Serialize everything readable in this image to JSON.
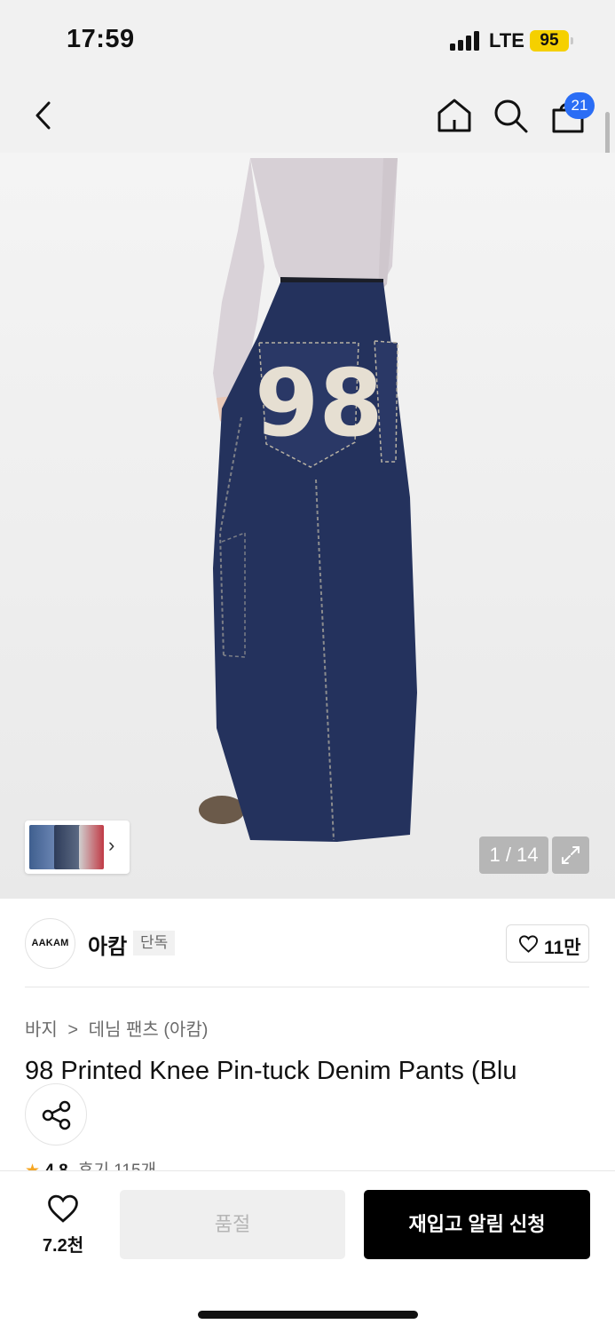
{
  "status_bar": {
    "time": "17:59",
    "network": "LTE",
    "battery": "95",
    "battery_color": "#f5d000"
  },
  "header": {
    "icons": [
      "back-icon",
      "home-icon",
      "search-icon",
      "shopping-bag-icon"
    ],
    "cart_count": "21",
    "badge_color": "#2a6df5"
  },
  "product_image": {
    "print_text": "98",
    "page_indicator": "1 / 14",
    "thumbnail_count": 3
  },
  "brand": {
    "logo_text": "AAKAM",
    "name": "아캄",
    "badge": "단독",
    "likes": "11만"
  },
  "breadcrumb": {
    "category": "바지",
    "separator": ">",
    "subcategory": "데님 팬츠 (아캄)"
  },
  "product": {
    "title": "98 Printed Knee Pin-tuck Denim Pants (Blu",
    "rating": "4.8",
    "reviews": "후기 115개"
  },
  "bottom_bar": {
    "wish_count": "7.2천",
    "soldout_label": "품절",
    "restock_label": "재입고 알림 신청"
  }
}
